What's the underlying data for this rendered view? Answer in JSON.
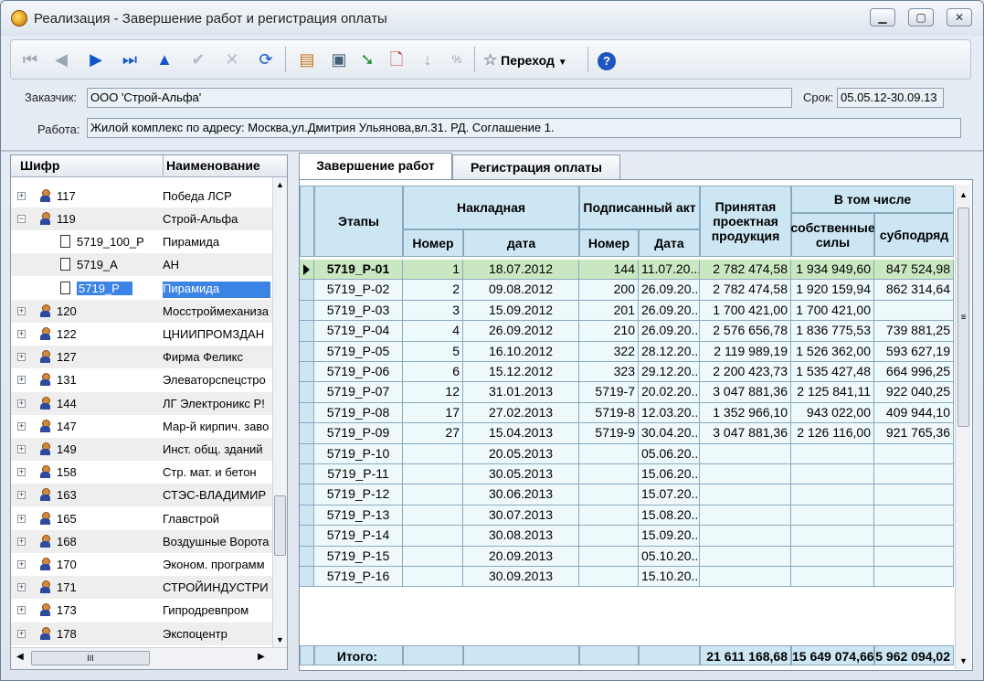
{
  "window": {
    "title": "Реализация - Завершение работ и регистрация оплаты"
  },
  "toolbar": {
    "goto_label": "Переход",
    "percent_label": "%"
  },
  "form": {
    "customer_label": "Заказчик:",
    "customer_value": "ООО 'Строй-Альфа'",
    "deadline_label": "Срок:",
    "deadline_value": "05.05.12-30.09.13",
    "work_label": "Работа:",
    "work_value": "Жилой комплекс по адресу: Москва,ул.Дмитрия Ульянова,вл.31. РД. Соглашение 1."
  },
  "tree": {
    "col_code": "Шифр",
    "col_name": "Наименование",
    "top_name": "Победа ЛСР",
    "top_code": "117",
    "rows": [
      {
        "code": "119",
        "name": "Строй-Альфа",
        "kind": "org",
        "expander": "−"
      },
      {
        "code": "5719_100_P",
        "name": "Пирамида",
        "kind": "doc"
      },
      {
        "code": "5719_A",
        "name": "АН",
        "kind": "doc"
      },
      {
        "code": "5719_P",
        "name": "Пирамида",
        "kind": "doc",
        "selected": true
      },
      {
        "code": "120",
        "name": "Мосстроймеханиза",
        "kind": "org",
        "expander": "+"
      },
      {
        "code": "122",
        "name": "ЦНИИПРОМЗДАН",
        "kind": "org",
        "expander": "+"
      },
      {
        "code": "127",
        "name": "Фирма Феликс",
        "kind": "org",
        "expander": "+"
      },
      {
        "code": "131",
        "name": "Элеваторспецстро",
        "kind": "org",
        "expander": "+"
      },
      {
        "code": "144",
        "name": "ЛГ Электроникс Р!",
        "kind": "org",
        "expander": "+"
      },
      {
        "code": "147",
        "name": "Мар-й кирпич. заво",
        "kind": "org",
        "expander": "+"
      },
      {
        "code": "149",
        "name": "Инст. общ. зданий",
        "kind": "org",
        "expander": "+"
      },
      {
        "code": "158",
        "name": "Стр. мат. и бетон",
        "kind": "org",
        "expander": "+"
      },
      {
        "code": "163",
        "name": "СТЭС-ВЛАДИМИР",
        "kind": "org",
        "expander": "+"
      },
      {
        "code": "165",
        "name": "Главстрой",
        "kind": "org",
        "expander": "+"
      },
      {
        "code": "168",
        "name": "Воздушные Ворота",
        "kind": "org",
        "expander": "+"
      },
      {
        "code": "170",
        "name": "Эконом. программ",
        "kind": "org",
        "expander": "+"
      },
      {
        "code": "171",
        "name": "СТРОЙИНДУСТРИ",
        "kind": "org",
        "expander": "+"
      },
      {
        "code": "173",
        "name": "Гипродревпром",
        "kind": "org",
        "expander": "+"
      },
      {
        "code": "178",
        "name": "Экспоцентр",
        "kind": "org",
        "expander": "+"
      }
    ],
    "hscroll_thumb": "III"
  },
  "tabs": [
    {
      "label": "Завершение работ",
      "active": true
    },
    {
      "label": "Регистрация оплаты",
      "active": false
    }
  ],
  "grid": {
    "headers": {
      "stages": "Этапы",
      "invoice": "Накладная",
      "invoice_num": "Номер",
      "invoice_date": "дата",
      "act": "Подписанный акт",
      "act_num": "Номер",
      "act_date": "Дата",
      "accepted": "Принятая проектная продукция",
      "including": "В том числе",
      "own": "собственные силы",
      "sub": "субподряд"
    },
    "rows": [
      {
        "stage": "5719_P-01",
        "inv_num": "1",
        "inv_date": "18.07.2012",
        "act_num": "144",
        "act_date": "11.07.20...",
        "accepted": "2 782 474,58",
        "own": "1 934 949,60",
        "sub": "847 524,98"
      },
      {
        "stage": "5719_P-02",
        "inv_num": "2",
        "inv_date": "09.08.2012",
        "act_num": "200",
        "act_date": "26.09.20...",
        "accepted": "2 782 474,58",
        "own": "1 920 159,94",
        "sub": "862 314,64"
      },
      {
        "stage": "5719_P-03",
        "inv_num": "3",
        "inv_date": "15.09.2012",
        "act_num": "201",
        "act_date": "26.09.20...",
        "accepted": "1 700 421,00",
        "own": "1 700 421,00",
        "sub": ""
      },
      {
        "stage": "5719_P-04",
        "inv_num": "4",
        "inv_date": "26.09.2012",
        "act_num": "210",
        "act_date": "26.09.20...",
        "accepted": "2 576 656,78",
        "own": "1 836 775,53",
        "sub": "739 881,25"
      },
      {
        "stage": "5719_P-05",
        "inv_num": "5",
        "inv_date": "16.10.2012",
        "act_num": "322",
        "act_date": "28.12.20...",
        "accepted": "2 119 989,19",
        "own": "1 526 362,00",
        "sub": "593 627,19"
      },
      {
        "stage": "5719_P-06",
        "inv_num": "6",
        "inv_date": "15.12.2012",
        "act_num": "323",
        "act_date": "29.12.20...",
        "accepted": "2 200 423,73",
        "own": "1 535 427,48",
        "sub": "664 996,25"
      },
      {
        "stage": "5719_P-07",
        "inv_num": "12",
        "inv_date": "31.01.2013",
        "act_num": "5719-7",
        "act_date": "20.02.20...",
        "accepted": "3 047 881,36",
        "own": "2 125 841,11",
        "sub": "922 040,25"
      },
      {
        "stage": "5719_P-08",
        "inv_num": "17",
        "inv_date": "27.02.2013",
        "act_num": "5719-8",
        "act_date": "12.03.20...",
        "accepted": "1 352 966,10",
        "own": "943 022,00",
        "sub": "409 944,10"
      },
      {
        "stage": "5719_P-09",
        "inv_num": "27",
        "inv_date": "15.04.2013",
        "act_num": "5719-9",
        "act_date": "30.04.20...",
        "accepted": "3 047 881,36",
        "own": "2 126 116,00",
        "sub": "921 765,36"
      },
      {
        "stage": "5719_P-10",
        "inv_num": "",
        "inv_date": "20.05.2013",
        "act_num": "",
        "act_date": "05.06.20...",
        "accepted": "",
        "own": "",
        "sub": ""
      },
      {
        "stage": "5719_P-11",
        "inv_num": "",
        "inv_date": "30.05.2013",
        "act_num": "",
        "act_date": "15.06.20...",
        "accepted": "",
        "own": "",
        "sub": ""
      },
      {
        "stage": "5719_P-12",
        "inv_num": "",
        "inv_date": "30.06.2013",
        "act_num": "",
        "act_date": "15.07.20...",
        "accepted": "",
        "own": "",
        "sub": ""
      },
      {
        "stage": "5719_P-13",
        "inv_num": "",
        "inv_date": "30.07.2013",
        "act_num": "",
        "act_date": "15.08.20...",
        "accepted": "",
        "own": "",
        "sub": ""
      },
      {
        "stage": "5719_P-14",
        "inv_num": "",
        "inv_date": "30.08.2013",
        "act_num": "",
        "act_date": "15.09.20...",
        "accepted": "",
        "own": "",
        "sub": ""
      },
      {
        "stage": "5719_P-15",
        "inv_num": "",
        "inv_date": "20.09.2013",
        "act_num": "",
        "act_date": "05.10.20...",
        "accepted": "",
        "own": "",
        "sub": ""
      },
      {
        "stage": "5719_P-16",
        "inv_num": "",
        "inv_date": "30.09.2013",
        "act_num": "",
        "act_date": "15.10.20...",
        "accepted": "",
        "own": "",
        "sub": ""
      }
    ],
    "footer": {
      "label": "Итого:",
      "accepted": "21 611 168,68",
      "own": "15 649 074,66",
      "sub": "5 962 094,02"
    }
  },
  "colors": {
    "header_bg": "#cde6f4",
    "current_row": "#c9e8c2",
    "selection": "#3b84e6"
  }
}
